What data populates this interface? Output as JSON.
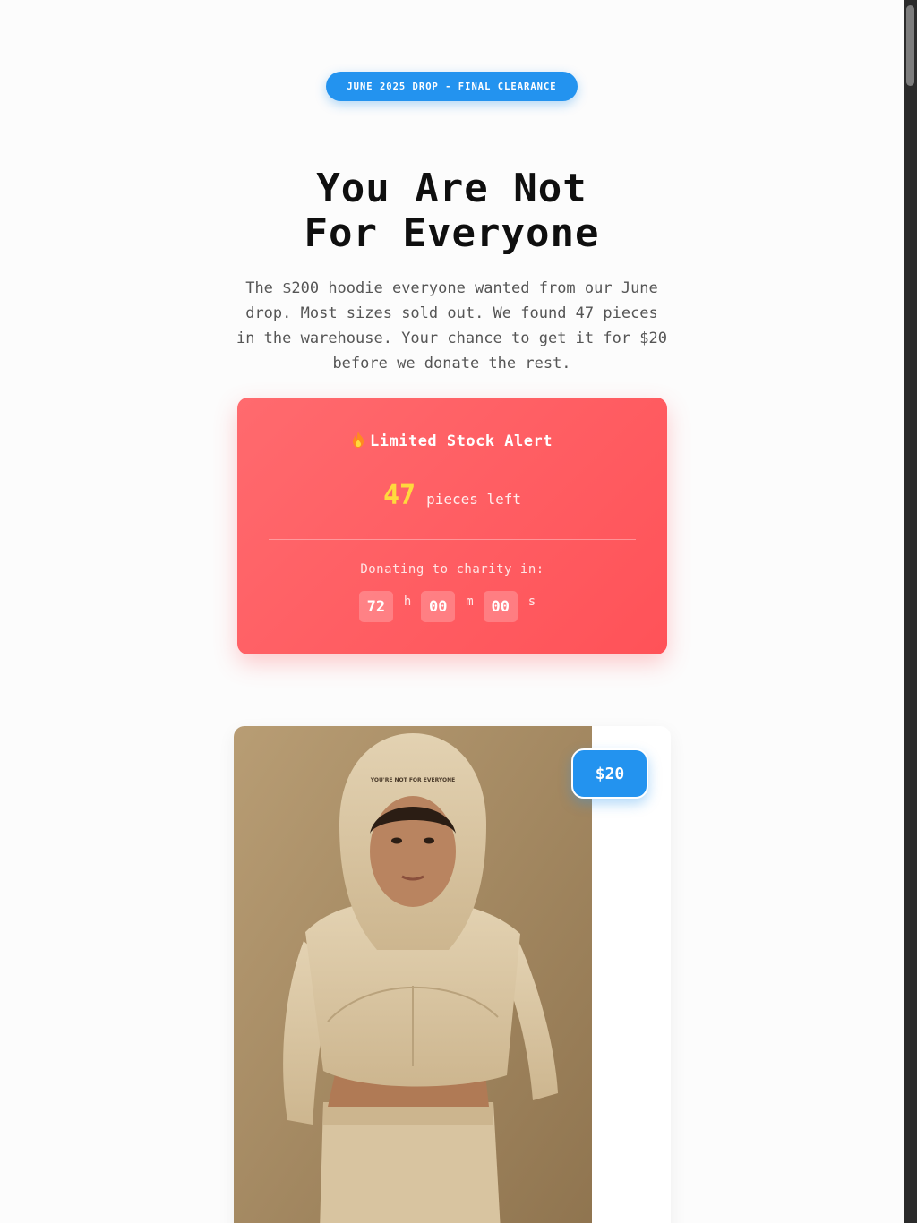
{
  "badge": {
    "label": "JUNE 2025 DROP - FINAL CLEARANCE"
  },
  "hero": {
    "title_line1": "You Are Not",
    "title_line2": "For Everyone",
    "subtitle": "The $200 hoodie everyone wanted from our June drop. Most sizes sold out. We found 47 pieces in the warehouse. Your chance to get it for $20 before we donate the rest."
  },
  "stock_alert": {
    "icon": "fire-icon",
    "heading": "Limited Stock Alert",
    "count": "47",
    "count_label": "pieces left",
    "donate_label": "Donating to charity in:",
    "timer": {
      "hours": "72",
      "hours_unit": "h",
      "minutes": "00",
      "minutes_unit": "m",
      "seconds": "00",
      "seconds_unit": "s"
    }
  },
  "product": {
    "price": "$20",
    "hood_print": "YOU'RE NOT FOR EVERYONE"
  },
  "colors": {
    "accent_blue": "#2393ef",
    "alert_red": "#ff5a5f",
    "count_yellow": "#ffd93d",
    "hoodie_beige": "#d9c6a2"
  }
}
